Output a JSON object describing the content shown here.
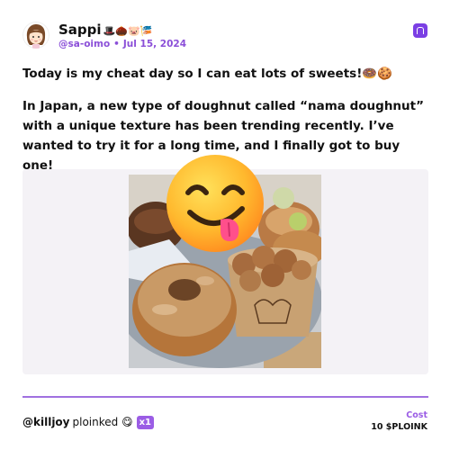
{
  "post": {
    "display_name": "Sappi",
    "name_emojis": "🎩🌰🐷🎏",
    "handle": "@sa-oimo",
    "separator": "•",
    "date": "Jul 15, 2024",
    "headline": "Today is my cheat day so I can eat lots of sweets!🍩🍪",
    "body": "In Japan, a new type of doughnut called “nama doughnut” with a unique texture has been trending recently. I’ve wanted to try it for a long time, and I finally got to buy one!"
  },
  "media": {
    "sticker_icon": "face-savoring-food-icon",
    "photo_subject": "doughnuts-photo"
  },
  "footer": {
    "plonk_user": "@killjoy",
    "plonk_verb": "ploinked",
    "plonk_emoji": "😋",
    "multiplier": "x1",
    "cost_label": "Cost",
    "cost_value": "10 $PLOINK"
  },
  "colors": {
    "accent": "#8b4fd8",
    "divider": "#a070e0",
    "badge": "#9b5de5"
  }
}
